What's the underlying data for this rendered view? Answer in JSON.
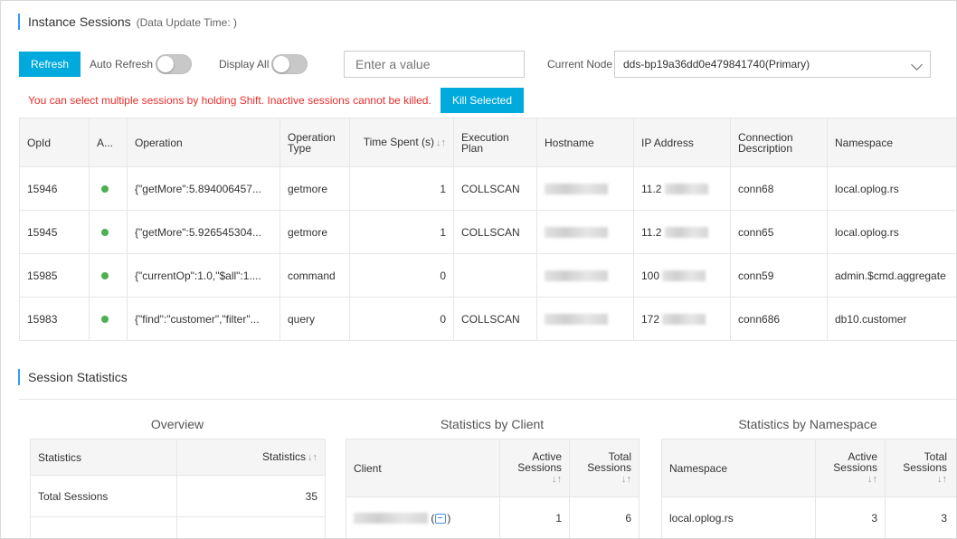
{
  "header": {
    "title": "Instance Sessions",
    "subtitle": "(Data Update Time: )"
  },
  "toolbar": {
    "refresh_label": "Refresh",
    "auto_refresh_label": "Auto Refresh",
    "auto_refresh_on": false,
    "display_all_label": "Display All",
    "display_all_on": false,
    "search_placeholder": "Enter a value",
    "current_node_label": "Current Node",
    "current_node_value": "dds-bp19a36dd0e479841740(Primary)"
  },
  "warning": "You can select multiple sessions by holding Shift. Inactive sessions cannot be killed.",
  "kill_selected_label": "Kill Selected",
  "sessions_table": {
    "columns": [
      "OpId",
      "A...",
      "Operation",
      "Operation Type",
      "Time Spent (s)",
      "Execution Plan",
      "Hostname",
      "IP Address",
      "Connection Description",
      "Namespace"
    ],
    "rows": [
      {
        "opid": "15946",
        "operation": "{\"getMore\":5.894006457...",
        "op_type": "getmore",
        "time_spent": "1",
        "plan": "COLLSCAN",
        "ip_prefix": "11.2",
        "conn": "conn68",
        "namespace": "local.oplog.rs"
      },
      {
        "opid": "15945",
        "operation": "{\"getMore\":5.926545304...",
        "op_type": "getmore",
        "time_spent": "1",
        "plan": "COLLSCAN",
        "ip_prefix": "11.2",
        "conn": "conn65",
        "namespace": "local.oplog.rs"
      },
      {
        "opid": "15985",
        "operation": "{\"currentOp\":1.0,\"$all\":1....",
        "op_type": "command",
        "time_spent": "0",
        "plan": "",
        "ip_prefix": "100",
        "conn": "conn59",
        "namespace": "admin.$cmd.aggregate"
      },
      {
        "opid": "15983",
        "operation": "{\"find\":\"customer\",\"filter\"...",
        "op_type": "query",
        "time_spent": "0",
        "plan": "COLLSCAN",
        "ip_prefix": "172",
        "conn": "conn686",
        "namespace": "db10.customer"
      }
    ]
  },
  "statistics": {
    "title": "Session Statistics",
    "overview": {
      "title": "Overview",
      "col1": "Statistics",
      "col2": "Statistics",
      "rows": [
        {
          "label": "Total Sessions",
          "value": "35"
        }
      ]
    },
    "by_client": {
      "title": "Statistics by Client",
      "col1": "Client",
      "col2": "Active Sessions",
      "col3": "Total Sessions",
      "rows": [
        {
          "open": "(",
          "close": ")",
          "active": "1",
          "total": "6"
        }
      ]
    },
    "by_namespace": {
      "title": "Statistics by Namespace",
      "col1": "Namespace",
      "col2": "Active Sessions",
      "col3": "Total Sessions",
      "rows": [
        {
          "namespace": "local.oplog.rs",
          "active": "3",
          "total": "3"
        }
      ]
    }
  }
}
